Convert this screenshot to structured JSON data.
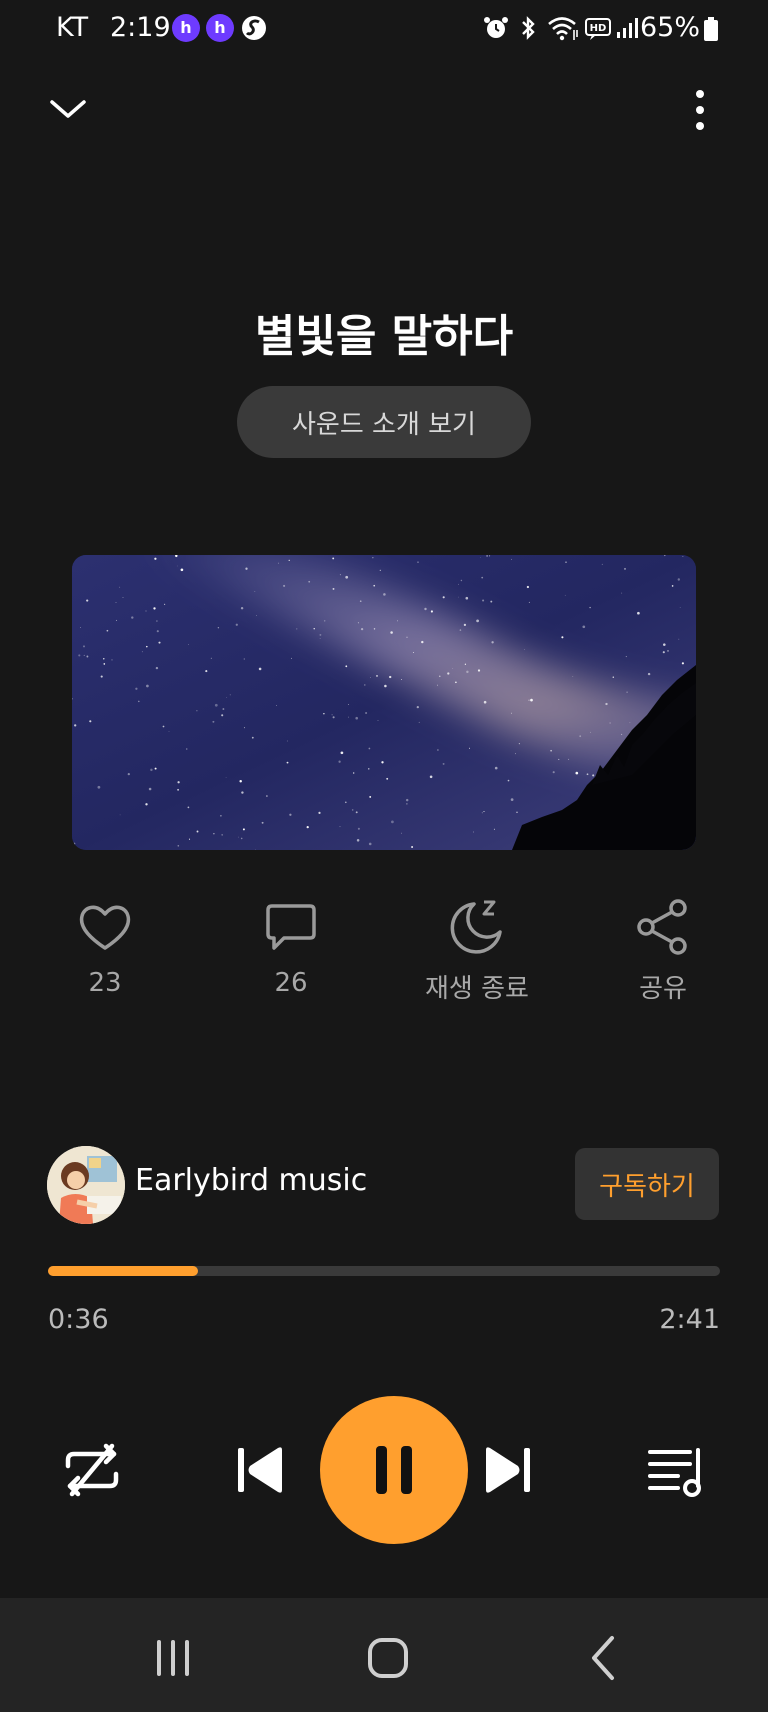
{
  "status_bar": {
    "carrier": "KT",
    "time": "2:19",
    "battery": "65%",
    "icons": [
      "app-badge-icon",
      "app-badge-icon",
      "s-app-icon",
      "alarm-icon",
      "bluetooth-icon",
      "wifi-icon",
      "hd-voice-icon",
      "signal-icon",
      "battery-icon"
    ]
  },
  "header": {
    "collapse_icon": "chevron-down-icon",
    "more_icon": "more-vertical-icon"
  },
  "track": {
    "title": "별빛을 말하다",
    "intro_button": "사운드 소개 보기"
  },
  "actions": {
    "like": {
      "icon": "heart-icon",
      "label": "23"
    },
    "comment": {
      "icon": "comment-icon",
      "label": "26"
    },
    "sleep": {
      "icon": "sleep-timer-icon",
      "label": "재생 종료"
    },
    "share": {
      "icon": "share-icon",
      "label": "공유"
    }
  },
  "channel": {
    "name": "Earlybird music",
    "subscribe_label": "구독하기"
  },
  "progress": {
    "current": "0:36",
    "total": "2:41",
    "fraction": 0.2236
  },
  "controls": {
    "repeat": "repeat-icon",
    "previous": "skip-previous-icon",
    "play_pause": "pause-icon",
    "next": "skip-next-icon",
    "queue": "playlist-icon"
  },
  "colors": {
    "accent": "#ff9f2e",
    "background": "#171717"
  },
  "nav_bar": {
    "recent": "recent-apps-icon",
    "home": "home-icon",
    "back": "back-icon"
  }
}
